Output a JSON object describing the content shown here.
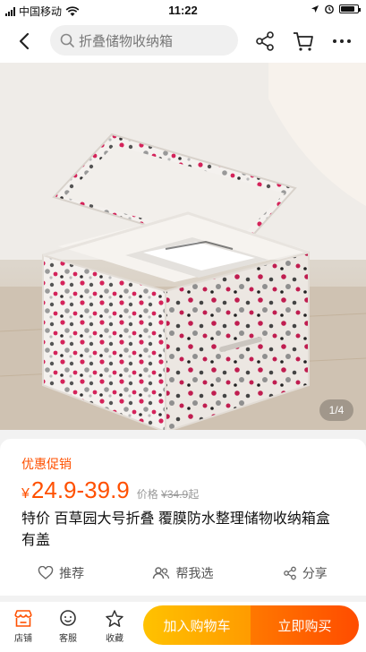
{
  "status_bar": {
    "carrier": "中国移动",
    "time": "11:22",
    "battery_level": 0.85
  },
  "navbar": {
    "search_text": "折叠储物收纳箱",
    "icons": [
      "back-icon",
      "search-icon",
      "share-icon",
      "cart-icon",
      "more-icon"
    ]
  },
  "hero": {
    "pager": "1/4"
  },
  "product": {
    "promo_label": "优惠促销",
    "currency": "¥",
    "price_range": "24.9-39.9",
    "price_label": "价格",
    "original_currency": "¥",
    "original_price": "34.9",
    "original_suffix": "起",
    "title": "特价 百草园大号折叠 覆膜防水整理储物收纳箱盒 有盖"
  },
  "actions": [
    {
      "label": "推荐",
      "icon": "heart-icon"
    },
    {
      "label": "帮我选",
      "icon": "people-icon"
    },
    {
      "label": "分享",
      "icon": "share-icon"
    }
  ],
  "bottom_bar": {
    "tabs": [
      {
        "label": "店铺",
        "icon": "store-icon"
      },
      {
        "label": "客服",
        "icon": "service-icon"
      },
      {
        "label": "收藏",
        "icon": "star-icon"
      }
    ],
    "add_to_cart": "加入购物车",
    "buy_now": "立即购买"
  },
  "colors": {
    "accent": "#ff5000",
    "cart_button": "#ffb000",
    "buy_button": "#ff5a00"
  }
}
